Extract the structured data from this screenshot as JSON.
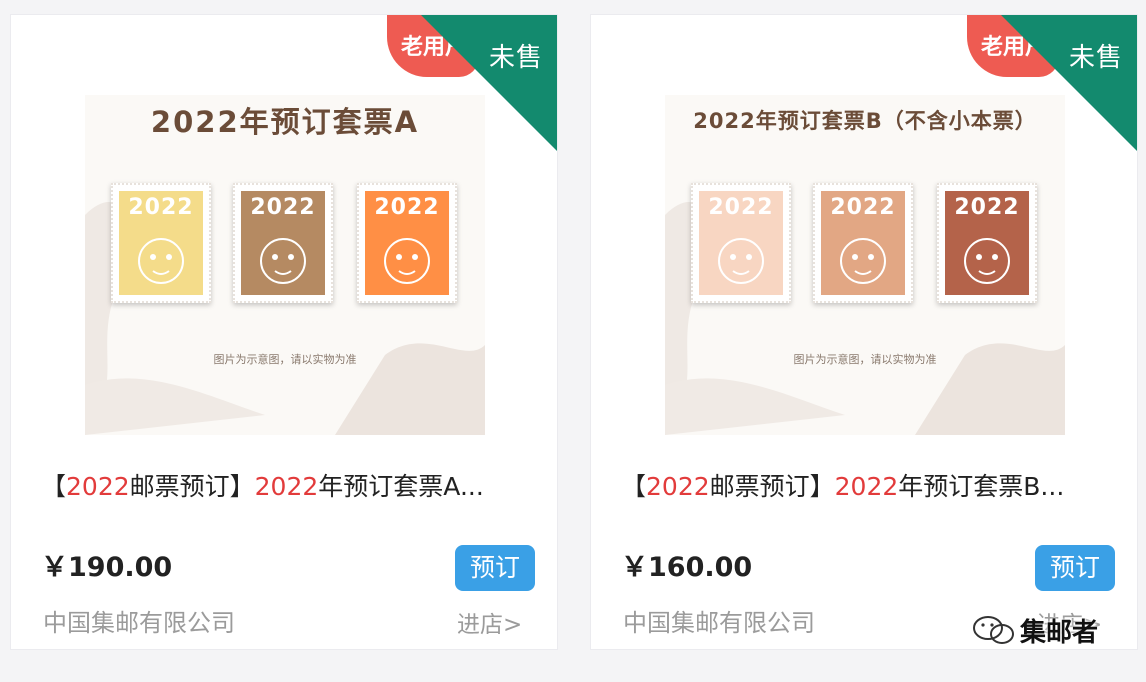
{
  "products": [
    {
      "id_label": "A",
      "sheet_title": "2022年预订套票A",
      "stamp_year": "2022",
      "stamp_colors": [
        "#f4dc8a",
        "#b58a62",
        "#ff8f45"
      ],
      "image_caption": "图片为示意图，请以实物为准",
      "badge_old": "老用户",
      "ribbon": "未售",
      "title_prefix_open": "【",
      "title_prefix_red": "2022",
      "title_prefix_rest": "邮票预订】",
      "title_red": "2022",
      "title_rest": "年预订套票A...",
      "price": "￥190.00",
      "button": "预订",
      "seller": "中国集邮有限公司",
      "enter": "进店>"
    },
    {
      "id_label": "B",
      "sheet_title": "2022年预订套票B（不含小本票）",
      "stamp_year": "2022",
      "stamp_colors": [
        "#f8d6c2",
        "#e2a784",
        "#b4634a"
      ],
      "image_caption": "图片为示意图，请以实物为准",
      "badge_old": "老用户",
      "ribbon": "未售",
      "title_prefix_open": "【",
      "title_prefix_red": "2022",
      "title_prefix_rest": "邮票预订】",
      "title_red": "2022",
      "title_rest": "年预订套票B...",
      "price": "￥160.00",
      "button": "预订",
      "seller": "中国集邮有限公司",
      "enter": "进店>"
    }
  ],
  "watermark": {
    "text": "集邮者",
    "icon": "wechat-icon"
  },
  "colors": {
    "ribbon": "#138a6e",
    "badge": "#ee5b52",
    "button": "#3aa0e6",
    "title_red": "#e23b3b"
  }
}
